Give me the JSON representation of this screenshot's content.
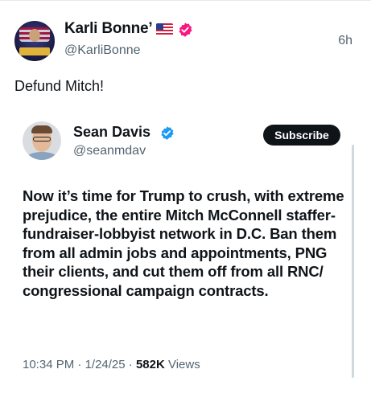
{
  "post": {
    "display_name": "Karli Bonne’",
    "handle": "@KarliBonne",
    "timestamp": "6h",
    "text": "Defund Mitch!",
    "avatar_icon": "profile-avatar",
    "flag_icon": "us-flag-icon",
    "verified_color": "#f91880"
  },
  "quote": {
    "display_name": "Sean Davis",
    "handle": "@seanmdav",
    "subscribe_label": "Subscribe",
    "verified_color": "#1d9bf0",
    "body": "Now it’s time for Trump to crush, with extreme prejudice, the entire Mitch McConnell staffer-fundraiser-lobbyist network in D.C. Ban them from all admin jobs and appointments, PNG their clients, and cut them off from all RNC/ congressional campaign contracts.",
    "time": "10:34 PM",
    "date": "1/24/25",
    "views_count": "582K",
    "views_label": "Views",
    "separator": "·"
  }
}
